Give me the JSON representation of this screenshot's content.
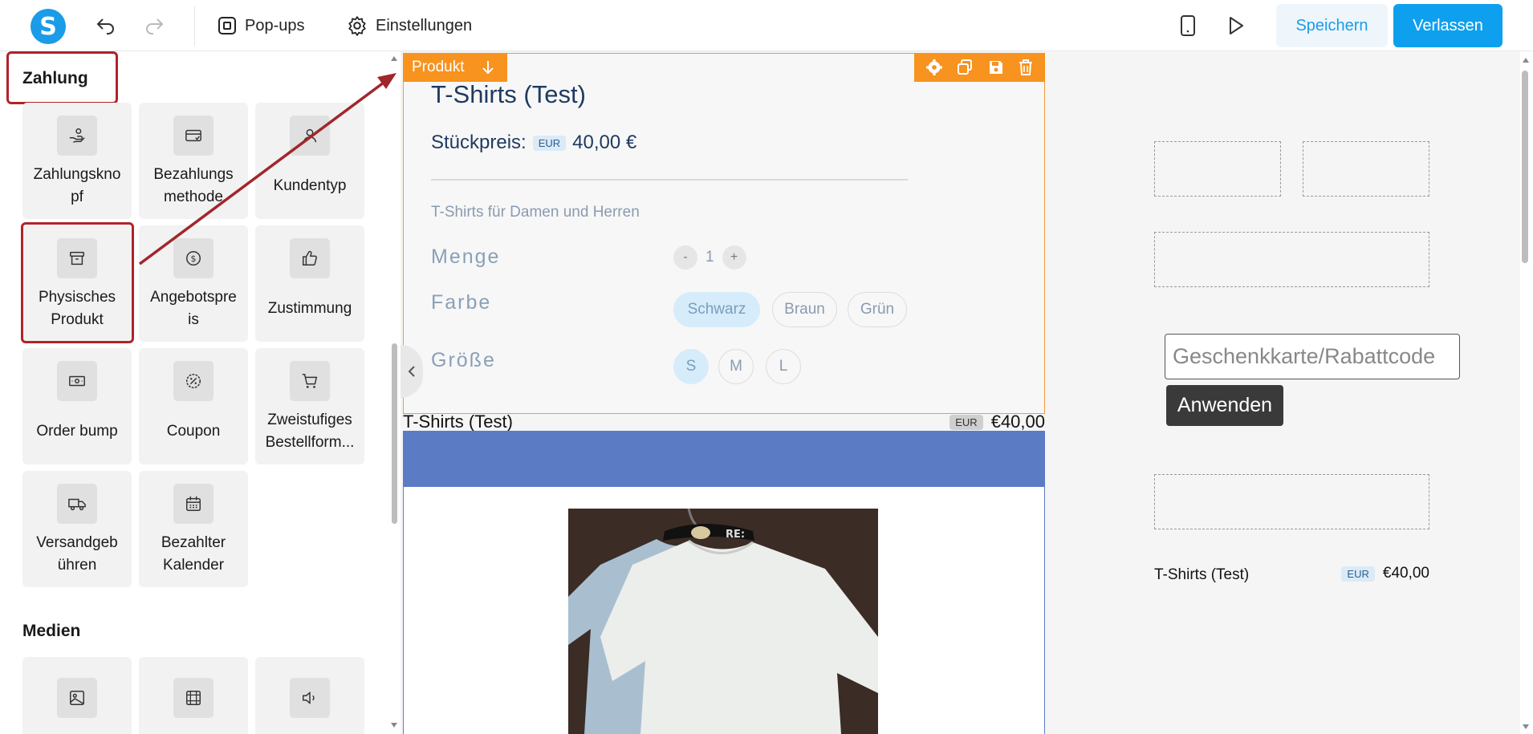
{
  "topbar": {
    "logo_letter": "S",
    "popups_label": "Pop-ups",
    "settings_label": "Einstellungen",
    "save_label": "Speichern",
    "exit_label": "Verlassen"
  },
  "sidebar": {
    "payment_title": "Zahlung",
    "payment_items": [
      {
        "label": "Zahlungskno\npf",
        "icon": "hand-coin-icon"
      },
      {
        "label": "Bezahlungs\nmethode",
        "icon": "credit-card-icon"
      },
      {
        "label": "Kundentyp",
        "icon": "user-icon"
      },
      {
        "label": "Physisches\nProdukt",
        "icon": "box-icon"
      },
      {
        "label": "Angebotspre\nis",
        "icon": "dollar-circle-icon"
      },
      {
        "label": "Zustimmung",
        "icon": "thumbs-up-icon"
      },
      {
        "label": "Order bump",
        "icon": "cash-icon"
      },
      {
        "label": "Coupon",
        "icon": "percent-badge-icon"
      },
      {
        "label": "Zweistufiges\nBestellform...",
        "icon": "cart-icon"
      },
      {
        "label": "Versandgeb\nühren",
        "icon": "truck-icon"
      },
      {
        "label": "Bezahlter\nKalender",
        "icon": "calendar-icon"
      }
    ],
    "media_title": "Medien",
    "media_items": [
      {
        "icon": "image-icon"
      },
      {
        "icon": "video-icon"
      },
      {
        "icon": "speaker-icon"
      }
    ]
  },
  "product": {
    "tag": "Produkt",
    "title": "T-Shirts (Test)",
    "price_label": "Stückpreis:",
    "currency": "EUR",
    "price": "40,00 €",
    "description": "T-Shirts für Damen und Herren",
    "qty_label": "Menge",
    "qty_minus": "-",
    "qty_value": "1",
    "qty_plus": "+",
    "color_label": "Farbe",
    "colors": [
      "Schwarz",
      "Braun",
      "Grün"
    ],
    "size_label": "Größe",
    "sizes": [
      "S",
      "M",
      "L"
    ]
  },
  "summary": {
    "name": "T-Shirts (Test)",
    "currency": "EUR",
    "price": "€40,00"
  },
  "right": {
    "gift_placeholder": "Geschenkkarte/Rabattcode",
    "apply_label": "Anwenden",
    "summary_name": "T-Shirts (Test)",
    "summary_currency": "EUR",
    "summary_price": "€40,00"
  }
}
